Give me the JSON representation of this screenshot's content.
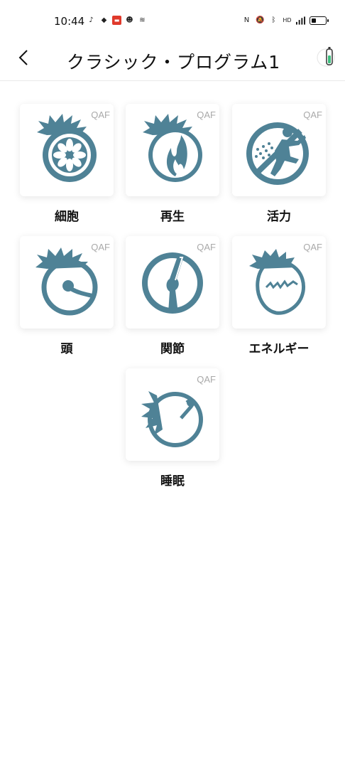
{
  "status": {
    "time": "10:44",
    "left_icons": [
      "tiktok-icon",
      "cube-icon",
      "red-app-icon",
      "robot-icon",
      "sensor-icon"
    ],
    "right_icons": [
      "nfc-icon",
      "mute-icon",
      "bluetooth-icon",
      "hd-icon",
      "signal-icon",
      "battery-icon"
    ]
  },
  "header": {
    "title": "クラシック・プログラム1",
    "back_icon": "chevron-left-icon",
    "device_icon": "device-battery-icon"
  },
  "colors": {
    "icon": "#4f8296",
    "tag": "#a9a9a9",
    "device_accent": "#3fbf7f"
  },
  "programs": [
    {
      "label": "細胞",
      "tag": "QAF",
      "icon": "cell-icon"
    },
    {
      "label": "再生",
      "tag": "QAF",
      "icon": "flame-icon"
    },
    {
      "label": "活力",
      "tag": "QAF",
      "icon": "runner-icon"
    },
    {
      "label": "頭",
      "tag": "QAF",
      "icon": "head-icon"
    },
    {
      "label": "関節",
      "tag": "QAF",
      "icon": "joint-icon"
    },
    {
      "label": "エネルギー",
      "tag": "QAF",
      "icon": "energy-icon"
    },
    {
      "label": "睡眠",
      "tag": "QAF",
      "icon": "sleep-icon"
    }
  ]
}
